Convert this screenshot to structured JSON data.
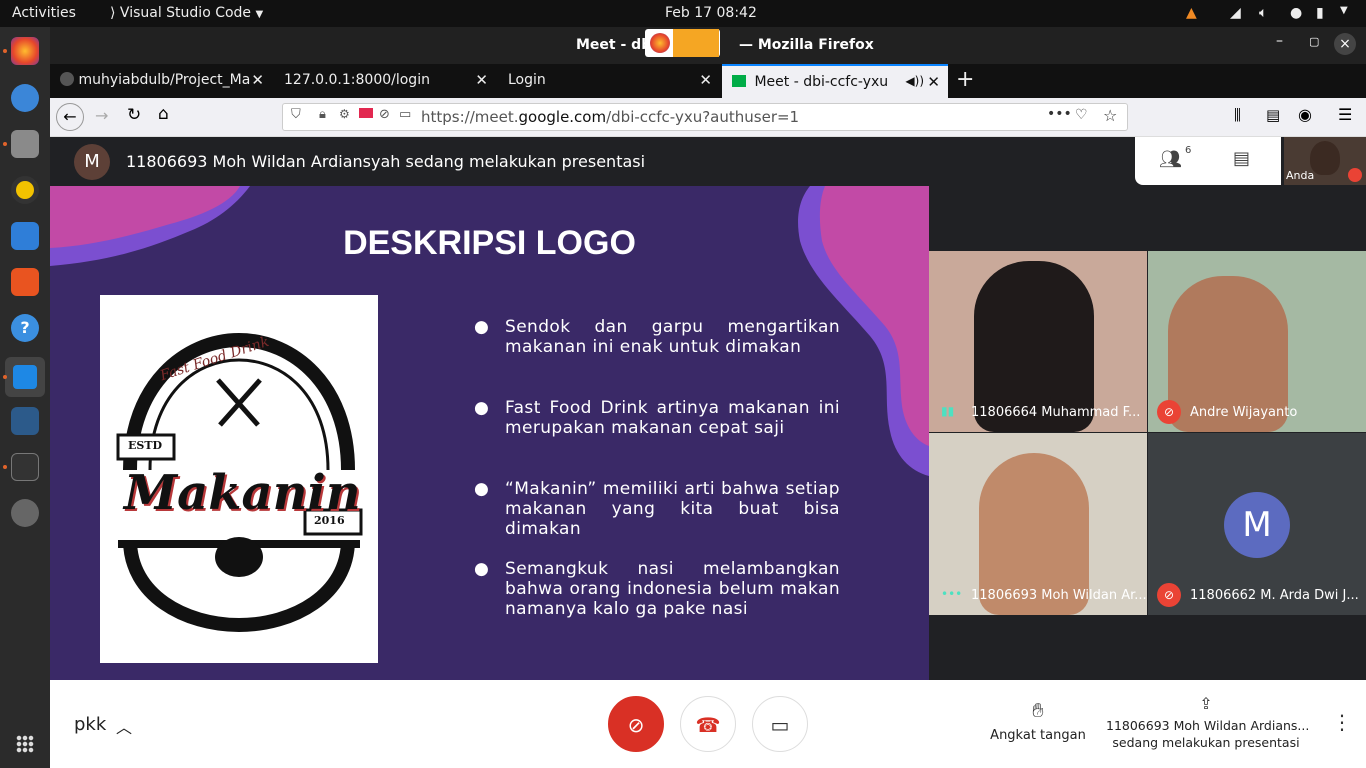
{
  "topbar": {
    "activities": "Activities",
    "app": "Visual Studio Code",
    "datetime": "Feb 17  08:42"
  },
  "window": {
    "title": "Meet - db                  — Mozilla Firefox"
  },
  "tabs": [
    {
      "label": "muhyiabdulb/Project_Ma"
    },
    {
      "label": "127.0.0.1:8000/login"
    },
    {
      "label": "Login"
    },
    {
      "label": "Meet - dbi-ccfc-yxu"
    }
  ],
  "url": {
    "prefix": "https://meet.",
    "domain": "google.com",
    "path": "/dbi-ccfc-yxu?authuser=1"
  },
  "meet": {
    "presenter_initial": "M",
    "presenter_banner": "11806693 Moh Wildan Ardiansyah sedang melakukan presentasi",
    "people_count": "6",
    "self_label": "Anda"
  },
  "slide": {
    "title": "DESKRIPSI LOGO",
    "logo": {
      "tagline": "Fast Food Drink",
      "estd": "ESTD",
      "brand": "Makanin",
      "year": "2016"
    },
    "bullets": [
      "Sendok dan garpu mengartikan makanan ini enak untuk dimakan",
      "Fast Food Drink artinya makanan ini merupakan makanan cepat saji",
      "“Makanin” memiliki arti bahwa setiap makanan yang kita buat bisa dimakan",
      "Semangkuk nasi melambangkan bahwa orang indonesia belum makan namanya kalo ga pake nasi"
    ]
  },
  "participants": [
    {
      "name": "11806664 Muhammad F..."
    },
    {
      "name": "Andre Wijayanto"
    },
    {
      "name": "11806693 Moh Wildan Ar..."
    },
    {
      "name": "11806662 M. Arda Dwi J...",
      "initial": "M"
    }
  ],
  "bottom": {
    "meeting_name": "pkk",
    "raise_hand": "Angkat tangan",
    "presenting_line1": "11806693 Moh Wildan Ardians...",
    "presenting_line2": "sedang melakukan presentasi"
  },
  "colors": {
    "slide_bg": "#3a2967",
    "blob": "#b03aa0",
    "mic_off": "#ea4335",
    "avatar": "#5c6bc0"
  }
}
